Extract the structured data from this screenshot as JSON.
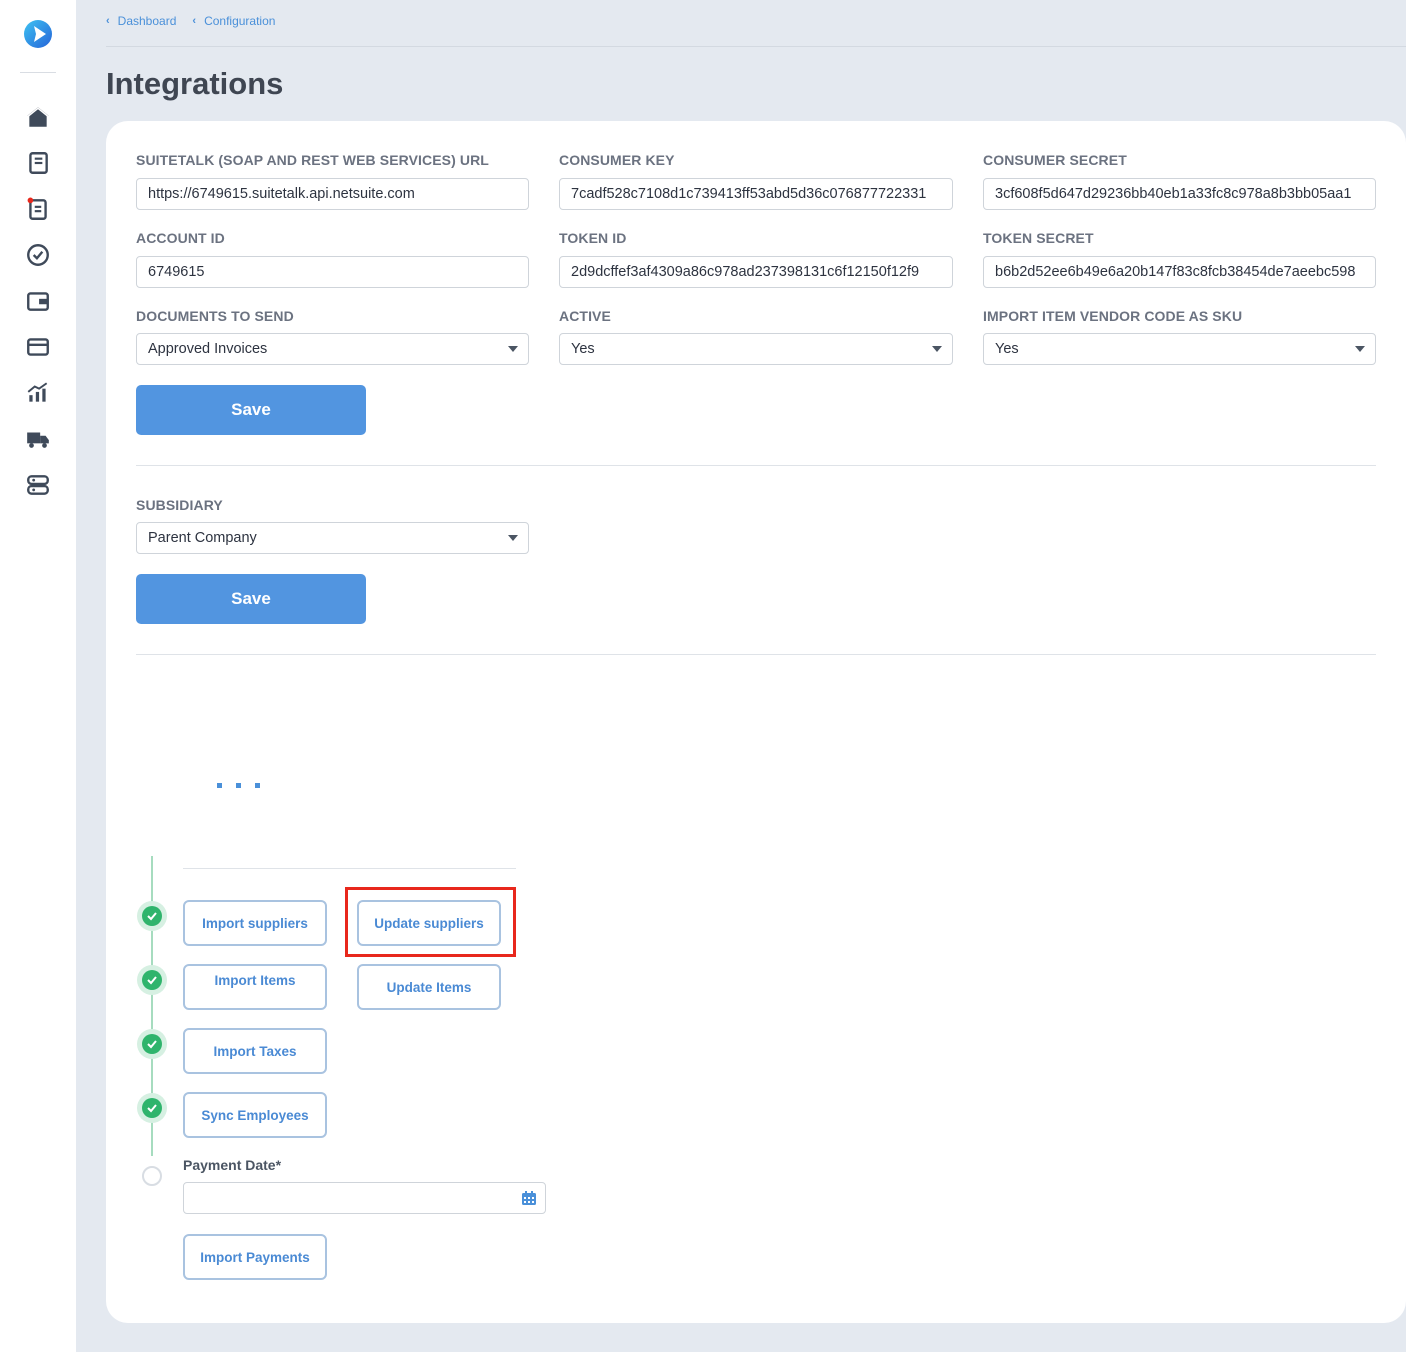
{
  "breadcrumb": {
    "items": [
      "Dashboard",
      "Configuration"
    ]
  },
  "page": {
    "title": "Integrations"
  },
  "form": {
    "suitetalk_url": {
      "label": "SUITETALK (SOAP AND REST WEB SERVICES) URL",
      "value": "https://6749615.suitetalk.api.netsuite.com"
    },
    "consumer_key": {
      "label": "CONSUMER KEY",
      "value": "7cadf528c7108d1c739413ff53abd5d36c076877722331"
    },
    "consumer_secret": {
      "label": "CONSUMER SECRET",
      "value": "3cf608f5d647d29236bb40eb1a33fc8c978a8b3bb05aa1"
    },
    "account_id": {
      "label": "ACCOUNT ID",
      "value": "6749615"
    },
    "token_id": {
      "label": "TOKEN ID",
      "value": "2d9dcffef3af4309a86c978ad237398131c6f12150f12f9"
    },
    "token_secret": {
      "label": "TOKEN SECRET",
      "value": "b6b2d52ee6b49e6a20b147f83c8fcb38454de7aeebc598"
    },
    "documents_to_send": {
      "label": "DOCUMENTS TO SEND",
      "value": "Approved Invoices"
    },
    "active": {
      "label": "ACTIVE",
      "value": "Yes"
    },
    "import_vendor_code": {
      "label": "IMPORT ITEM VENDOR CODE AS SKU",
      "value": "Yes"
    },
    "save_label": "Save"
  },
  "subsidiary": {
    "label": "SUBSIDIARY",
    "value": "Parent Company",
    "save_label": "Save"
  },
  "steps": {
    "import_suppliers": "Import suppliers",
    "update_suppliers": "Update suppliers",
    "import_items": "Import Items",
    "update_items": "Update Items",
    "import_taxes": "Import Taxes",
    "sync_employees": "Sync Employees",
    "payment_date_label": "Payment Date*",
    "payment_date_value": "",
    "import_payments": "Import Payments"
  },
  "colors": {
    "accent": "#5295e0",
    "success": "#2fb46c",
    "highlight": "#e8281c"
  },
  "icons": {
    "sidebar": [
      "home-icon",
      "receipt-icon",
      "document-alert-icon",
      "check-circle-icon",
      "wallet-icon",
      "card-icon",
      "chart-icon",
      "truck-icon",
      "server-icon"
    ]
  }
}
